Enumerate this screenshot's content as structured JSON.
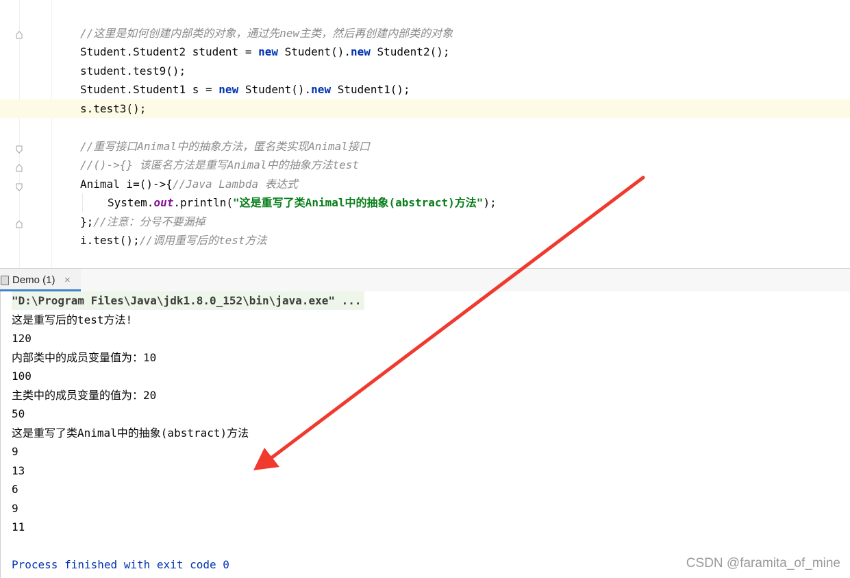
{
  "editor": {
    "lines": {
      "l1": "//这里是如何创建内部类的对象，通过先new主类，然后再创建内部类的对象",
      "l2a": "Student.Student2 student = ",
      "l2kw1": "new",
      "l2b": " Student().",
      "l2kw2": "new",
      "l2c": " Student2();",
      "l3": "student.test9();",
      "l4a": "Student.Student1 s = ",
      "l4kw1": "new",
      "l4b": " Student().",
      "l4kw2": "new",
      "l4c": " Student1();",
      "l5": "s.test3();",
      "l6": "//重写接口Animal中的抽象方法，匿名类实现Animal接口",
      "l7": "//()->{} 该匿名方法是重写Animal中的抽象方法test",
      "l8a": "Animal i=()->{",
      "l8cm": "//Java Lambda 表达式",
      "l9a": "System.",
      "l9fld": "out",
      "l9b": ".println(",
      "l9str": "\"这是重写了类Animal中的抽象(abstract)方法\"",
      "l9c": ");",
      "l10a": "};",
      "l10cm": "//注意：分号不要漏掉",
      "l11a": "i.test();",
      "l11cm": "//调用重写后的test方法"
    }
  },
  "run": {
    "tab_label": "Demo (1)",
    "close_glyph": "×"
  },
  "console": {
    "command": "\"D:\\Program Files\\Java\\jdk1.8.0_152\\bin\\java.exe\" ...",
    "output": [
      "这是重写后的test方法!",
      "120",
      "内部类中的成员变量值为：10",
      "100",
      "主类中的成员变量的值为：20",
      "50",
      "这是重写了类Animal中的抽象(abstract)方法",
      "9",
      "13",
      "6",
      "9",
      "11"
    ],
    "exit": "Process finished with exit code 0"
  },
  "watermark": "CSDN @faramita_of_mine",
  "colors": {
    "keyword": "#0033b3",
    "string": "#067d17",
    "comment": "#8c8c8c",
    "arrow": "#f03a2e"
  }
}
